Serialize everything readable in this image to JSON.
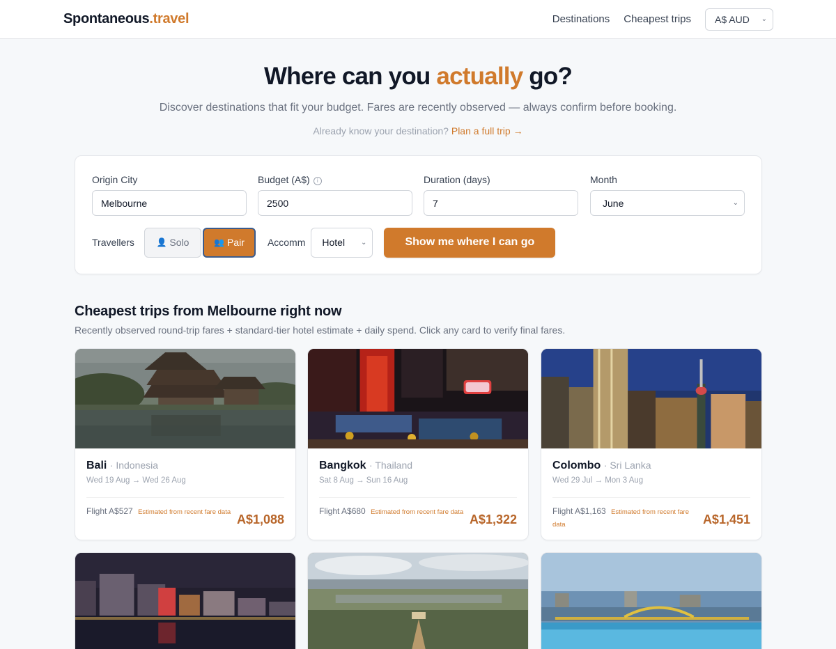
{
  "nav": {
    "logo_main": "Spontaneous",
    "logo_accent": ".travel",
    "links": [
      "Destinations",
      "Cheapest trips"
    ],
    "currency": "A$ AUD"
  },
  "hero": {
    "title_pre": "Where can you ",
    "title_accent": "actually",
    "title_post": " go?",
    "subtitle": "Discover destinations that fit your budget. Fares are recently observed — always confirm before booking.",
    "plan_prefix": "Already know your destination?",
    "plan_link": "Plan a full trip →"
  },
  "search": {
    "origin_label": "Origin City",
    "origin_value": "Melbourne",
    "budget_label": "Budget (A$)",
    "budget_value": "2500",
    "duration_label": "Duration (days)",
    "duration_value": "7",
    "month_label": "Month",
    "month_value": "June",
    "travellers_label": "Travellers",
    "solo_label": "Solo",
    "pair_label": "Pair",
    "accomm_label": "Accomm",
    "accomm_value": "Hotel",
    "cta_label": "Show me where I can go"
  },
  "results": {
    "title": "Cheapest trips from Melbourne right now",
    "subtitle": "Recently observed round-trip fares + standard-tier hotel estimate + daily spend. Click any card to verify final fares.",
    "cards": [
      {
        "city": "Bali",
        "country": "· Indonesia",
        "dates": "Wed 19 Aug → Wed 26 Aug",
        "flight": "Flight A$527",
        "estimate": "Estimated from recent fare data",
        "total": "A$1,088"
      },
      {
        "city": "Bangkok",
        "country": "· Thailand",
        "dates": "Sat 8 Aug → Sun 16 Aug",
        "flight": "Flight A$680",
        "estimate": "Estimated from recent fare data",
        "total": "A$1,322"
      },
      {
        "city": "Colombo",
        "country": "· Sri Lanka",
        "dates": "Wed 29 Jul → Mon 3 Aug",
        "flight": "Flight A$1,163",
        "estimate": "Estimated from recent fare data",
        "total": "A$1,451"
      }
    ]
  },
  "colors": {
    "accent": "#d07a2c",
    "price": "#b8662a",
    "pair_border": "#3b5b8c"
  }
}
